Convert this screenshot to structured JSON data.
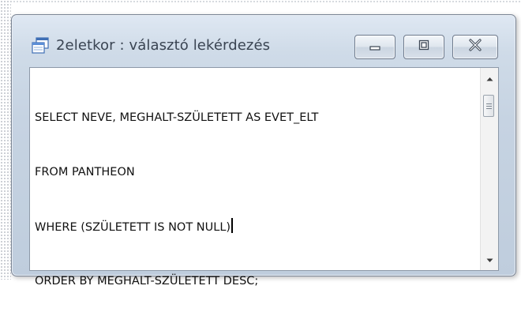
{
  "window": {
    "title": "2eletkor : választó lekérdezés",
    "icon": "query-window-icon",
    "buttons": {
      "minimize": "minimize-icon",
      "maximize": "maximize-icon",
      "close": "close-icon"
    }
  },
  "editor": {
    "lines": [
      "SELECT NEVE, MEGHALT-SZÜLETETT AS EVET_ELT",
      "FROM PANTHEON",
      "WHERE (SZÜLETETT IS NOT NULL)",
      "ORDER BY MEGHALT-SZÜLETETT DESC;"
    ]
  },
  "colors": {
    "frame_top": "#dfe8f3",
    "frame_bottom": "#bfcddd",
    "border": "#7a8595",
    "title_text": "#3a4452"
  }
}
